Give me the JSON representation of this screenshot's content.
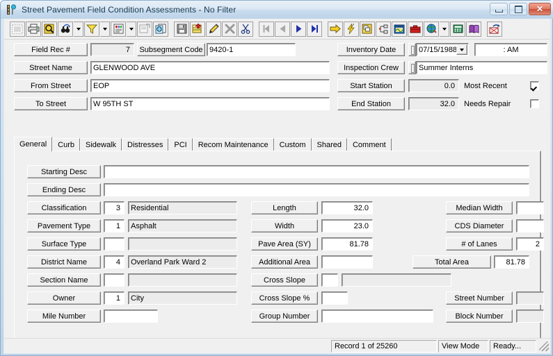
{
  "window": {
    "title": "Street Pavement Field Condition Assessments - No Filter",
    "icon": "road-marker-icon",
    "controls": {
      "minimize": "minimize-button",
      "maximize": "maximize-button",
      "close": "close-button"
    }
  },
  "toolbar": {
    "buttons": [
      {
        "name": "select-all-icon",
        "tip": "Select All"
      },
      {
        "name": "print-icon",
        "tip": "Print"
      },
      {
        "name": "print-preview-icon",
        "tip": "Print Preview"
      },
      {
        "name": "find-icon",
        "tip": "Find"
      },
      {
        "name": "filter-icon",
        "tip": "Filter"
      },
      {
        "name": "report-icon",
        "tip": "Report"
      },
      {
        "name": "form-properties-icon",
        "tip": "Form Properties"
      },
      {
        "name": "copy-records-icon",
        "tip": "Copy Records"
      },
      {
        "name": "save-icon",
        "tip": "Save"
      },
      {
        "name": "add-record-icon",
        "tip": "Add Record"
      },
      {
        "name": "edit-record-icon",
        "tip": "Edit Record"
      },
      {
        "name": "delete-record-icon",
        "tip": "Delete Record"
      },
      {
        "name": "cut-icon",
        "tip": "Cut"
      },
      {
        "name": "first-record-icon",
        "tip": "First Record"
      },
      {
        "name": "previous-record-icon",
        "tip": "Previous Record"
      },
      {
        "name": "next-record-icon",
        "tip": "Next Record"
      },
      {
        "name": "last-record-icon",
        "tip": "Last Record"
      },
      {
        "name": "goto-icon",
        "tip": "Go To"
      },
      {
        "name": "lightning-icon",
        "tip": "Quick Action"
      },
      {
        "name": "layers-icon",
        "tip": "Layers"
      },
      {
        "name": "hierarchy-icon",
        "tip": "Hierarchy"
      },
      {
        "name": "map-window-icon",
        "tip": "Map"
      },
      {
        "name": "toolbox-icon",
        "tip": "Toolbox"
      },
      {
        "name": "globe-icon",
        "tip": "Web"
      },
      {
        "name": "calculator-icon",
        "tip": "Calculator"
      },
      {
        "name": "help-book-icon",
        "tip": "Help"
      },
      {
        "name": "export-icon",
        "tip": "Export"
      }
    ]
  },
  "header": {
    "field_rec_label": "Field Rec #",
    "field_rec_value": "7",
    "subsegment_label": "Subsegment Code",
    "subsegment_value": "9420-1",
    "street_name_label": "Street Name",
    "street_name_value": "GLENWOOD AVE",
    "from_street_label": "From Street",
    "from_street_value": "EOP",
    "to_street_label": "To Street",
    "to_street_value": "W 95TH ST",
    "inventory_date_label": "Inventory Date",
    "inventory_date_value": "07/15/1988",
    "inventory_time_value": ":  AM",
    "inspection_crew_label": "Inspection Crew",
    "inspection_crew_value": "Summer Interns",
    "start_station_label": "Start Station",
    "start_station_value": "0.0",
    "end_station_label": "End Station",
    "end_station_value": "32.0",
    "most_recent_label": "Most Recent",
    "most_recent_checked": true,
    "needs_repair_label": "Needs Repair",
    "needs_repair_checked": false
  },
  "tabs": [
    {
      "label": "General",
      "active": true
    },
    {
      "label": "Curb",
      "active": false
    },
    {
      "label": "Sidewalk",
      "active": false
    },
    {
      "label": "Distresses",
      "active": false
    },
    {
      "label": "PCI",
      "active": false
    },
    {
      "label": "Recom Maintenance",
      "active": false
    },
    {
      "label": "Custom",
      "active": false
    },
    {
      "label": "Shared",
      "active": false
    },
    {
      "label": "Comment",
      "active": false
    }
  ],
  "general": {
    "col1": [
      {
        "label": "Starting Desc",
        "code": null,
        "value": "",
        "wide": true,
        "readonly": false
      },
      {
        "label": "Ending Desc",
        "code": null,
        "value": "",
        "wide": true,
        "readonly": false
      },
      {
        "label": "Classification",
        "code": "3",
        "value": "Residential",
        "wide": false,
        "readonly": true
      },
      {
        "label": "Pavement Type",
        "code": "1",
        "value": "Asphalt",
        "wide": false,
        "readonly": true
      },
      {
        "label": "Surface Type",
        "code": "",
        "value": "",
        "wide": false,
        "readonly": true
      },
      {
        "label": "District Name",
        "code": "4",
        "value": "Overland Park Ward 2",
        "wide": false,
        "readonly": true
      },
      {
        "label": "Section Name",
        "code": "",
        "value": "",
        "wide": false,
        "readonly": true
      },
      {
        "label": "Owner",
        "code": "1",
        "value": "City",
        "wide": false,
        "readonly": true
      },
      {
        "label": "Mile Number",
        "code": null,
        "value": "",
        "wide": false,
        "readonly": false
      }
    ],
    "col2": [
      {
        "label": "Length",
        "value": "32.0",
        "type": "num"
      },
      {
        "label": "Width",
        "value": "23.0",
        "type": "num"
      },
      {
        "label": "Pave Area (SY)",
        "value": "81.78",
        "type": "num"
      },
      {
        "label": "Additional Area",
        "value": "",
        "type": "num"
      },
      {
        "label": "Cross Slope",
        "value": "",
        "type": "code-desc"
      },
      {
        "label": "Cross Slope %",
        "value": "",
        "type": "small"
      },
      {
        "label": "Group Number",
        "value": "",
        "type": "long"
      }
    ],
    "col3": [
      {
        "label": "Median Width",
        "value": "",
        "readonly": false
      },
      {
        "label": "CDS Diameter",
        "value": "",
        "readonly": false
      },
      {
        "label": "# of Lanes",
        "value": "2",
        "readonly": false
      },
      {
        "label": "Total Area",
        "value": "81.78",
        "readonly": false,
        "wideLabel": true
      },
      {
        "label": "Street Number",
        "value": "",
        "readonly": true
      },
      {
        "label": "Block Number",
        "value": "",
        "readonly": true
      }
    ]
  },
  "statusbar": {
    "record": "Record 1 of 25260",
    "mode": "View Mode",
    "state": "Ready..."
  },
  "colors": {
    "face": "#f0f0f0",
    "field": "#ffffff",
    "field_readonly": "#ececec",
    "title_text": "#16384f",
    "frame": "#bfd4e8"
  }
}
